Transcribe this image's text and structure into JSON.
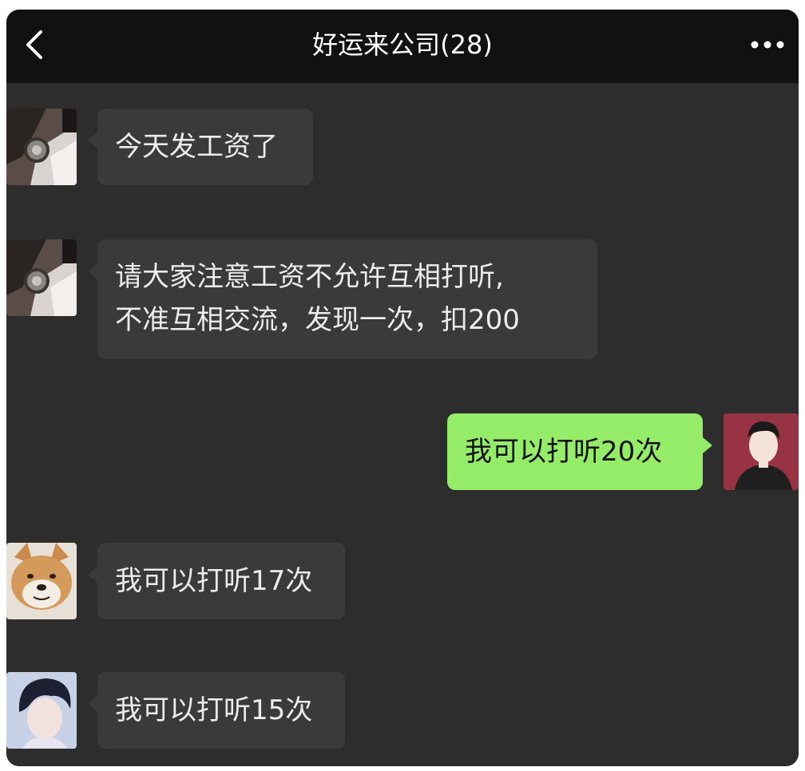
{
  "header": {
    "title": "好运来公司(28)",
    "back_icon": "chevron-left-icon",
    "more_icon": "more-dots-icon"
  },
  "messages": [
    {
      "direction": "incoming",
      "sender_avatar": "watch-avatar",
      "lines": [
        "今天发工资了"
      ]
    },
    {
      "direction": "incoming",
      "sender_avatar": "watch-avatar",
      "lines": [
        "请大家注意工资不允许互相打听,",
        "不准互相交流，发现一次，扣200"
      ]
    },
    {
      "direction": "outgoing",
      "sender_avatar": "cartoon-boy-avatar",
      "lines": [
        "我可以打听20次"
      ]
    },
    {
      "direction": "incoming",
      "sender_avatar": "shiba-dog-avatar",
      "lines": [
        "我可以打听17次"
      ]
    },
    {
      "direction": "incoming",
      "sender_avatar": "anime-boy-avatar",
      "lines": [
        "我可以打听15次"
      ]
    }
  ],
  "colors": {
    "chat_background": "#2d2d2d",
    "header_background": "#111111",
    "incoming_bubble": "#3a3a3a",
    "outgoing_bubble": "#95ec69"
  }
}
